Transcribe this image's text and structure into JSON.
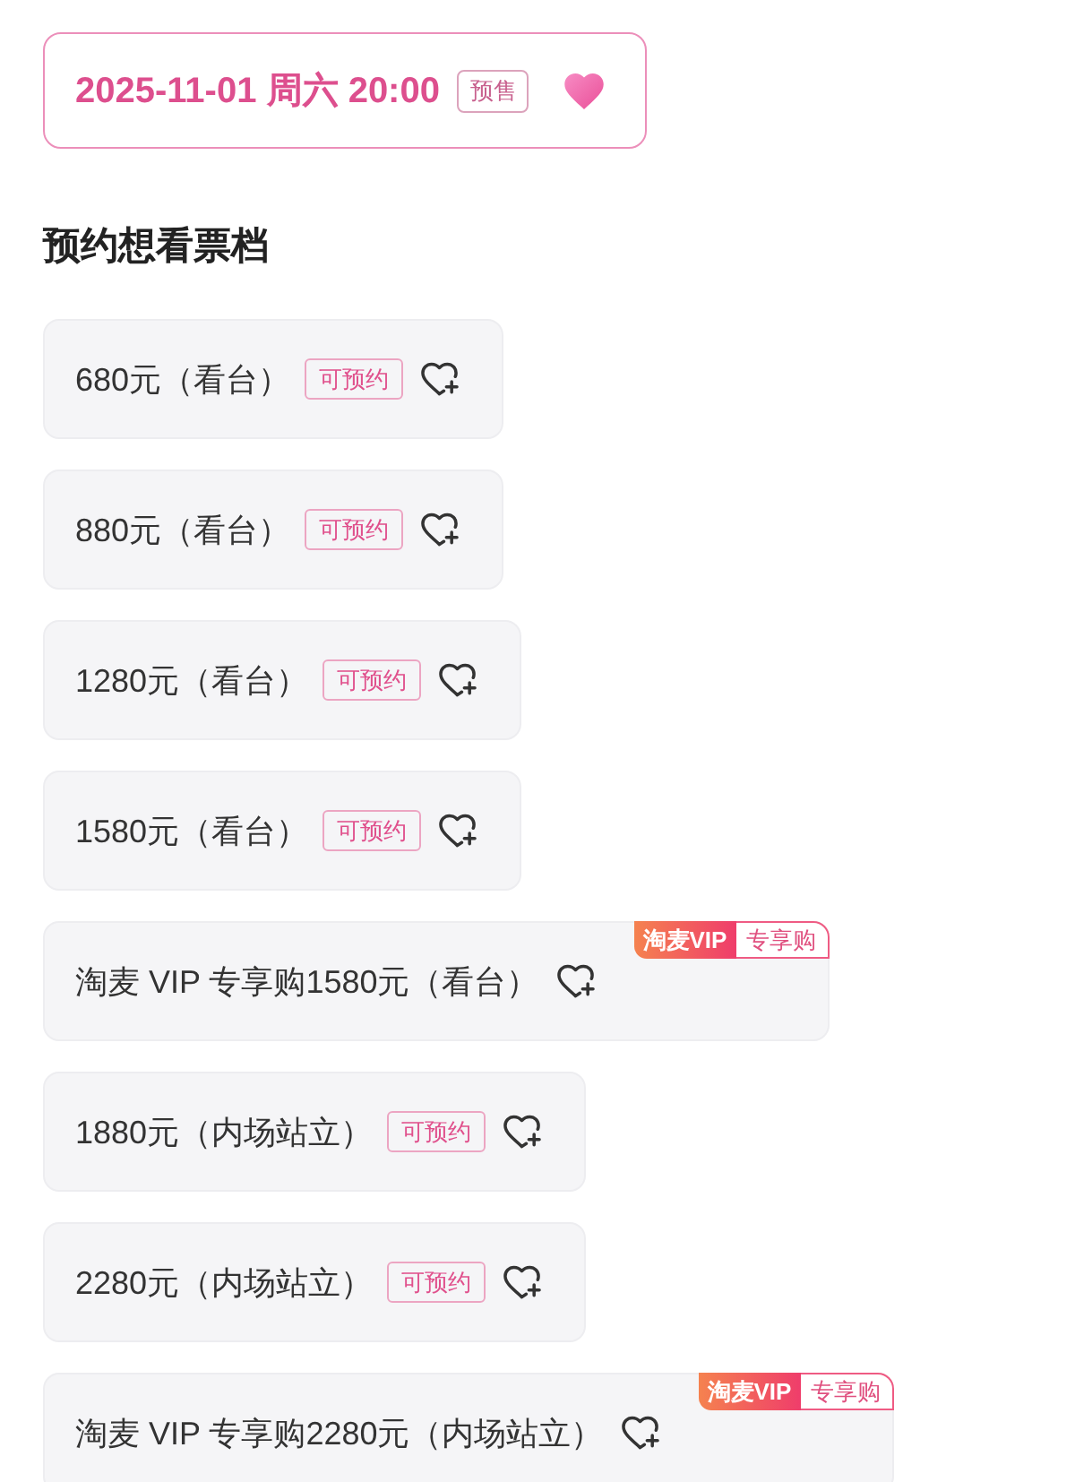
{
  "session": {
    "date_time": "2025-11-01 周六 20:00",
    "badge": "预售",
    "wished": true
  },
  "section_title": "预约想看票档",
  "tiers": [
    {
      "kind": "regular",
      "label": "680元（看台）",
      "badge": "可预约",
      "wished": false
    },
    {
      "kind": "regular",
      "label": "880元（看台）",
      "badge": "可预约",
      "wished": false
    },
    {
      "kind": "regular",
      "label": "1280元（看台）",
      "badge": "可预约",
      "wished": false
    },
    {
      "kind": "regular",
      "label": "1580元（看台）",
      "badge": "可预约",
      "wished": false
    },
    {
      "kind": "vip",
      "label": "淘麦 VIP 专享购1580元（看台）",
      "tag": {
        "brand": "淘麦VIP",
        "label": "专享购"
      },
      "wished": false
    },
    {
      "kind": "regular",
      "label": "1880元（内场站立）",
      "badge": "可预约",
      "wished": false
    },
    {
      "kind": "regular",
      "label": "2280元（内场站立）",
      "badge": "可预约",
      "wished": false
    },
    {
      "kind": "vip",
      "label": "淘麦 VIP 专享购2280元（内场站立）",
      "tag": {
        "brand": "淘麦VIP",
        "label": "专享购"
      },
      "wished": false
    }
  ]
}
